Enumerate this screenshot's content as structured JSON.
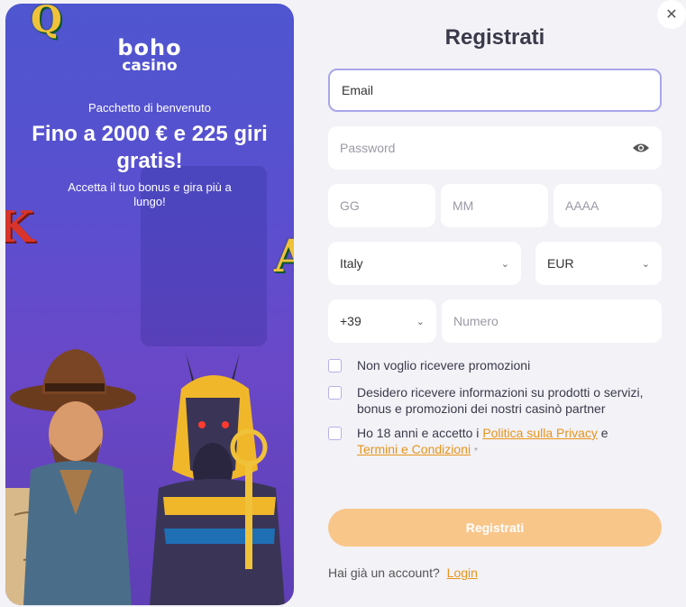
{
  "promo": {
    "logo_mark": "boho",
    "logo_sub": "casino",
    "welcome": "Pacchetto di benvenuto",
    "headline": "Fino a 2000 € e 225 giri gratis!",
    "subline": "Accetta il tuo bonus e gira più a lungo!"
  },
  "form": {
    "title": "Registrati",
    "email_placeholder": "Email",
    "password_placeholder": "Password",
    "day_placeholder": "GG",
    "month_placeholder": "MM",
    "year_placeholder": "AAAA",
    "country": "Italy",
    "currency": "EUR",
    "phone_prefix": "+39",
    "phone_placeholder": "Numero",
    "check_no_promo": "Non voglio ricevere promozioni",
    "check_partner": "Desidero ricevere informazioni su prodotti o servizi, bonus e promozioni dei nostri casinò partner",
    "check_age_prefix": "Ho 18 anni e accetto i ",
    "privacy_link": "Politica sulla Privacy",
    "check_age_and": " e",
    "terms_link": "Termini e Condizioni",
    "required_mark": "*",
    "submit_label": "Registrati",
    "have_account": "Hai già un account?",
    "login_link": "Login"
  },
  "colors": {
    "accent": "#e8941a",
    "submit_bg": "#f9c68a",
    "panel_bg": "#5a4fcf"
  },
  "icons": {
    "close": "close-icon",
    "password_toggle": "eye-icon",
    "dropdown": "chevron-down-icon"
  }
}
